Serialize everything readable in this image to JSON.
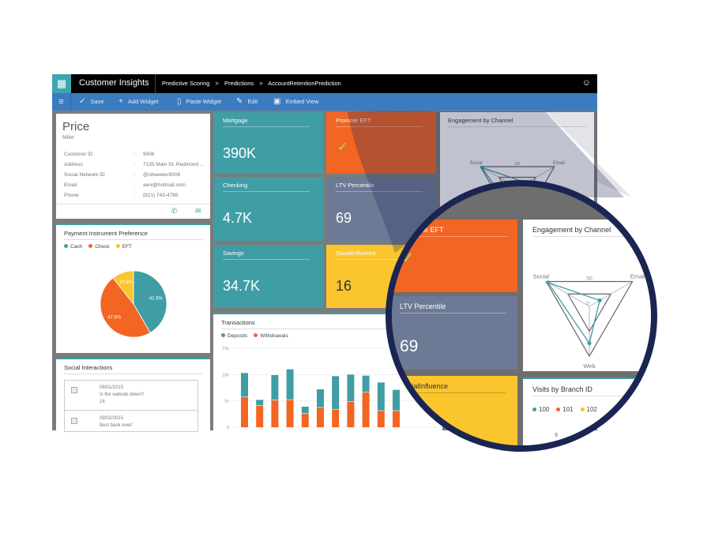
{
  "app": {
    "title": "Customer Insights",
    "breadcrumb": [
      "Predictive Scoring",
      ">",
      "Predictions",
      ">",
      "AccountRetentionPrediction"
    ],
    "apps_icon": "grid-icon",
    "user_icon": "person-icon"
  },
  "toolbar": {
    "menu_icon": "hamburger-icon",
    "items": [
      {
        "label": "Save",
        "icon": "check-icon"
      },
      {
        "label": "Add Widget",
        "icon": "plus-icon"
      },
      {
        "label": "Paste Widget",
        "icon": "clipboard-icon"
      },
      {
        "label": "Edit",
        "icon": "pencil-icon"
      },
      {
        "label": "Embed View",
        "icon": "embed-icon"
      }
    ]
  },
  "profile": {
    "last_name": "Price",
    "first_name": "Mike",
    "fields": [
      {
        "label": "Customer ID",
        "value": "9006"
      },
      {
        "label": "Address",
        "value": "7135 Main St, Redmond ..."
      },
      {
        "label": "Social Network ID",
        "value": "@citweeter9006"
      },
      {
        "label": "Email",
        "value": "aeni@hotmail.com"
      },
      {
        "label": "Phone",
        "value": "(821) 743-4789"
      }
    ],
    "sep": ":"
  },
  "payment": {
    "title": "Payment Instrument Preference"
  },
  "social": {
    "title": "Social Interactions",
    "items": [
      {
        "date": "08/01/2015",
        "text": "Is the website down?",
        "count": "16"
      },
      {
        "date": "09/02/2015",
        "text": "Best bank ever!"
      }
    ]
  },
  "tiles": [
    {
      "label": "Mortgage",
      "value": "390K"
    },
    {
      "label": "Checking",
      "value": "4.7K"
    },
    {
      "label": "Savings",
      "value": "34.7K"
    },
    {
      "label": "Promote EFT",
      "icon": "checkmark-icon"
    },
    {
      "label": "LTV Percentile",
      "value": "69"
    },
    {
      "label": "SocialInfluence",
      "value": "16"
    }
  ],
  "colors": {
    "teal": "#3f9da5",
    "orange": "#f26522",
    "yellow": "#fbc52d",
    "slate": "#6c7a96",
    "blue": "#3b7bc0",
    "navy": "#1b2553"
  },
  "engagement": {
    "title": "Engagement by Channel"
  },
  "visits": {
    "title": "Visits by Branch ID",
    "legend": [
      "100",
      "101",
      "102"
    ],
    "label": "9"
  },
  "transactions": {
    "title": "Transactions"
  },
  "chart_data": [
    {
      "type": "pie",
      "title": "Payment Instrument Preference",
      "slices": [
        {
          "name": "Cash",
          "value": 41.6,
          "label": "41.6%",
          "color": "#3f9da5"
        },
        {
          "name": "Check",
          "value": 47.8,
          "label": "47.8%",
          "color": "#f26522"
        },
        {
          "name": "EFT",
          "value": 10.6,
          "label": "10.6%",
          "color": "#fbc52d"
        }
      ],
      "legend": "top-left"
    },
    {
      "type": "bar",
      "stacked": true,
      "title": "Transactions",
      "ylim": [
        0,
        15000
      ],
      "yticks": [
        "15k",
        "10k",
        "5k",
        "0"
      ],
      "series": [
        {
          "name": "Deposits",
          "color": "#3f9da5",
          "values": [
            4600,
            1100,
            4800,
            5800,
            1300,
            3500,
            6400,
            5200,
            3200,
            5400,
            4000
          ]
        },
        {
          "name": "Withdrawals",
          "color": "#f26522",
          "values": [
            5700,
            4100,
            5100,
            5200,
            2600,
            3700,
            3300,
            4800,
            6600,
            3100,
            3100
          ]
        }
      ],
      "legend": "top-left",
      "grid": true
    },
    {
      "type": "radar",
      "title": "Engagement by Channel",
      "axes": [
        "Social",
        "Email",
        "Web"
      ],
      "ring_labels": [
        "0",
        "50"
      ],
      "rmax": 50,
      "series": [
        {
          "name": "100",
          "color": "#3f9da5",
          "values": [
            48,
            12,
            37
          ]
        }
      ]
    }
  ]
}
